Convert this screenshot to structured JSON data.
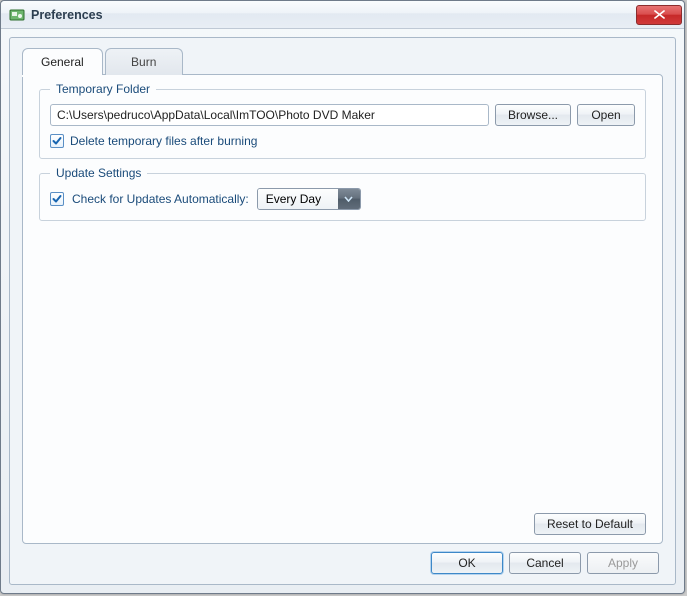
{
  "window": {
    "title": "Preferences"
  },
  "tabs": {
    "general": "General",
    "burn": "Burn"
  },
  "tempFolder": {
    "legend": "Temporary Folder",
    "path": "C:\\Users\\pedruco\\AppData\\Local\\ImTOO\\Photo DVD Maker",
    "browse": "Browse...",
    "open": "Open",
    "deleteTemp": "Delete temporary files after burning"
  },
  "updateSettings": {
    "legend": "Update Settings",
    "checkAuto": "Check for Updates Automatically:",
    "frequency": "Every Day"
  },
  "buttons": {
    "reset": "Reset to Default",
    "ok": "OK",
    "cancel": "Cancel",
    "apply": "Apply"
  }
}
